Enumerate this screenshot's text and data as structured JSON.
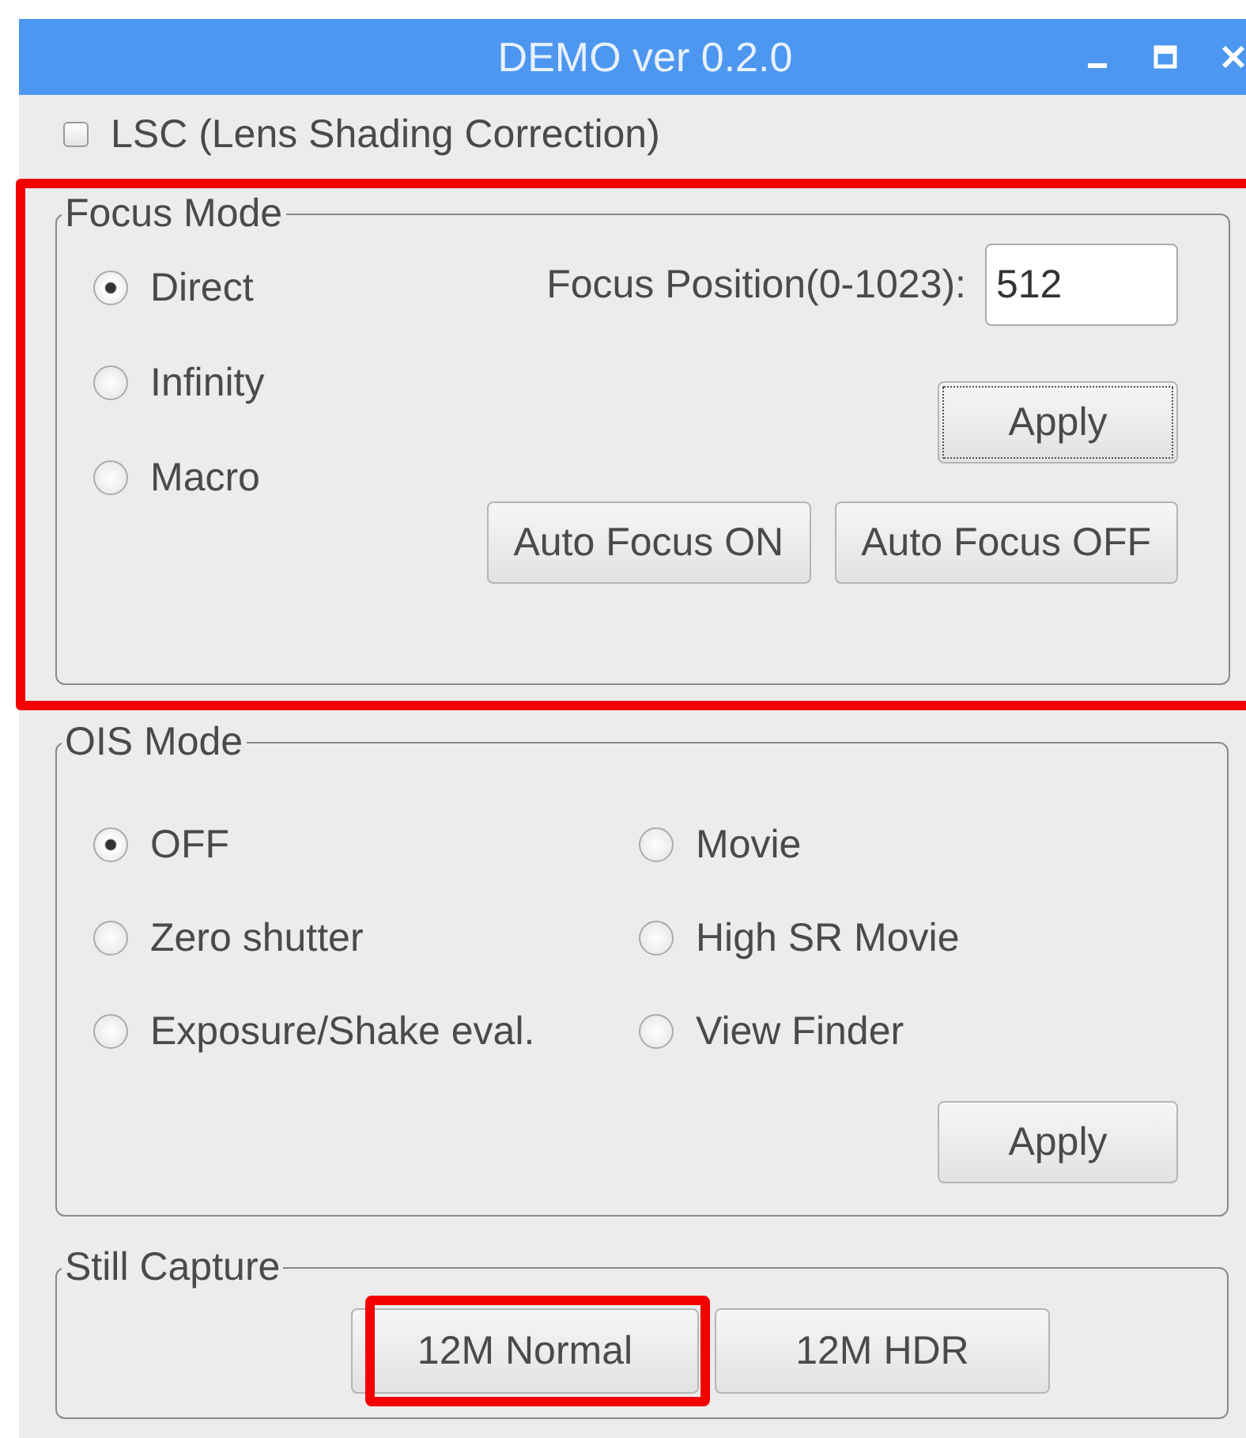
{
  "window": {
    "title": "DEMO ver 0.2.0"
  },
  "lsc": {
    "label": "LSC (Lens Shading Correction)",
    "checked": false
  },
  "focus_mode": {
    "title": "Focus Mode",
    "highlighted": true,
    "options": [
      {
        "label": "Direct",
        "selected": true
      },
      {
        "label": "Infinity",
        "selected": false
      },
      {
        "label": "Macro",
        "selected": false
      }
    ],
    "position_label": "Focus Position(0-1023):",
    "position_value": "512",
    "apply": {
      "label": "Apply",
      "focused": true
    },
    "buttons": [
      {
        "label": "Auto Focus ON",
        "focused": false
      },
      {
        "label": "Auto Focus OFF",
        "focused": false
      }
    ]
  },
  "ois_mode": {
    "title": "OIS Mode",
    "options": [
      {
        "label": "OFF",
        "selected": true
      },
      {
        "label": "Movie",
        "selected": false
      },
      {
        "label": "Zero shutter",
        "selected": false
      },
      {
        "label": "High SR Movie",
        "selected": false
      },
      {
        "label": "Exposure/Shake eval.",
        "selected": false
      },
      {
        "label": "View Finder",
        "selected": false
      }
    ],
    "apply": {
      "label": "Apply",
      "focused": false
    }
  },
  "still_capture": {
    "title": "Still Capture",
    "buttons": [
      {
        "label": "12M Normal",
        "highlighted": true
      },
      {
        "label": "12M HDR",
        "highlighted": false
      }
    ]
  }
}
